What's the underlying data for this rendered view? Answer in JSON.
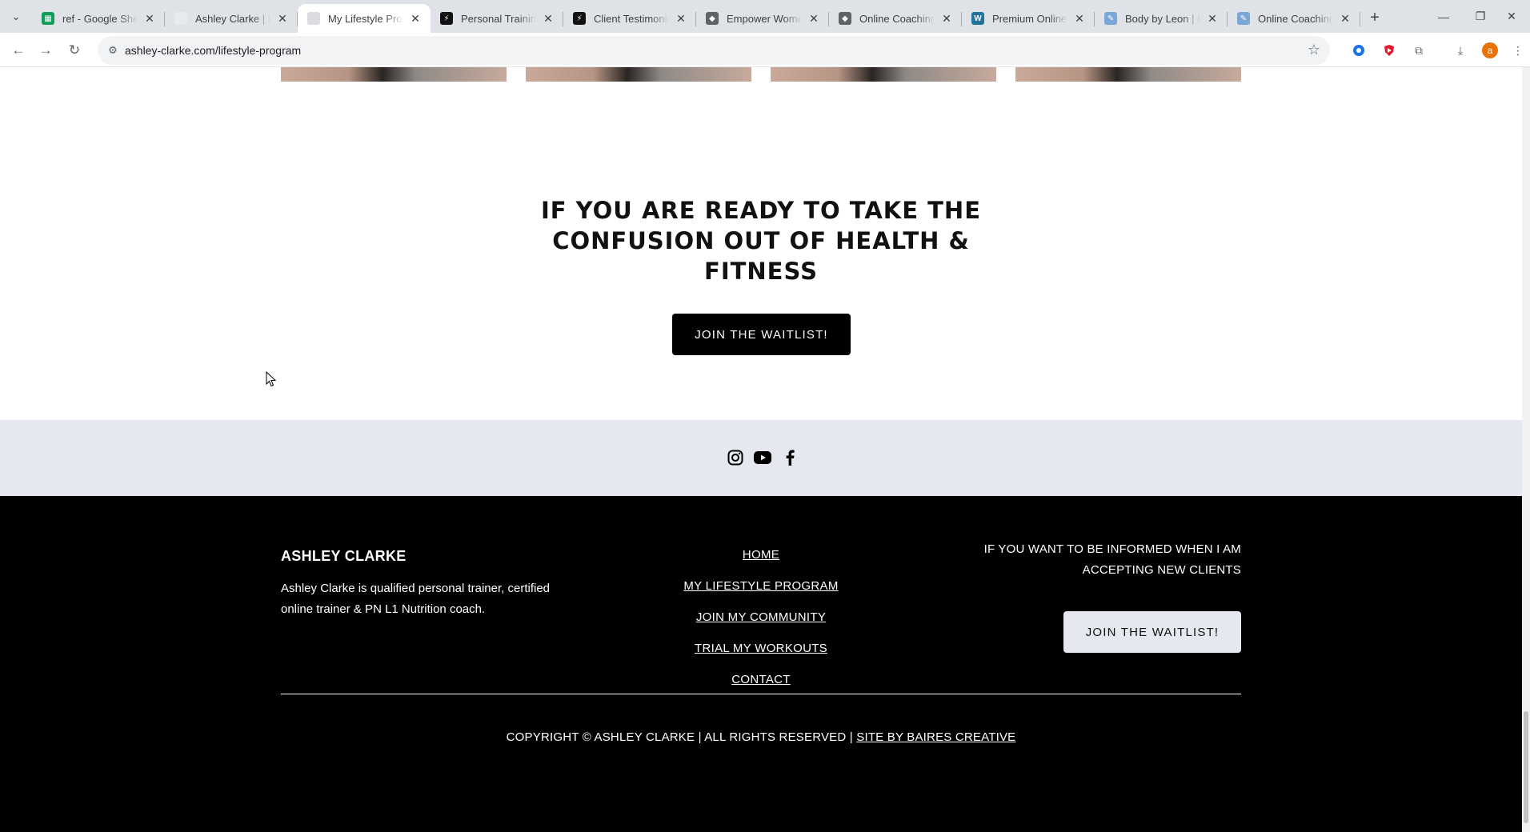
{
  "tabs": [
    {
      "title": "ref - Google Sheets",
      "favicon": "sheets-icon",
      "color": "#0f9d58",
      "glyph": "▦"
    },
    {
      "title": "Ashley Clarke | Lifestyle",
      "favicon": "blank-page-icon",
      "color": "#e8eaed",
      "glyph": ""
    },
    {
      "title": "My Lifestyle Program",
      "favicon": "blank-page-icon",
      "color": "#dadce0",
      "glyph": "",
      "active": true
    },
    {
      "title": "Personal Training",
      "favicon": "fitness-logo-icon",
      "color": "#111111",
      "glyph": "⚡"
    },
    {
      "title": "Client Testimonials",
      "favicon": "fitness-logo-icon",
      "color": "#111111",
      "glyph": "⚡"
    },
    {
      "title": "Empower Women",
      "favicon": "cube-icon",
      "color": "#5f6368",
      "glyph": "◆"
    },
    {
      "title": "Online Coaching",
      "favicon": "cube-icon",
      "color": "#5f6368",
      "glyph": "◆"
    },
    {
      "title": "Premium Online P",
      "favicon": "wordpress-icon",
      "color": "#21759b",
      "glyph": "W"
    },
    {
      "title": "Body by Leon | Pe",
      "favicon": "feather-icon",
      "color": "#7aa6d8",
      "glyph": "✎"
    },
    {
      "title": "Online Coaching",
      "favicon": "feather-icon",
      "color": "#7aa6d8",
      "glyph": "✎"
    }
  ],
  "toolbar": {
    "url": "ashley-clarke.com/lifestyle-program",
    "profile_initial": "a"
  },
  "cta": {
    "heading": "IF YOU ARE READY TO TAKE THE CONFUSION OUT OF HEALTH & FITNESS",
    "button": "JOIN THE WAITLIST!"
  },
  "social": [
    "instagram-icon",
    "youtube-icon",
    "facebook-icon"
  ],
  "footer": {
    "brand": "ASHLEY CLARKE",
    "about": "Ashley Clarke is qualified personal trainer, certified online trainer & PN L1 Nutrition coach.",
    "nav": [
      "HOME",
      "MY LIFESTYLE PROGRAM",
      "JOIN MY COMMUNITY",
      "TRIAL MY WORKOUTS",
      "CONTACT"
    ],
    "inform": "IF YOU WANT TO BE INFORMED WHEN I AM ACCEPTING NEW CLIENTS",
    "button": "JOIN THE WAITLIST!",
    "copyright": "COPYRIGHT © ASHLEY CLARKE | ALL RIGHTS RESERVED |",
    "credit": "SITE BY BAIRES CREATIVE"
  },
  "colors": {
    "footer_bg": "#000000",
    "social_band": "#e5e9ef",
    "profile_avatar": "#e8710a",
    "ext_red": "#e8182c",
    "ext_blue": "#1a73e8"
  }
}
